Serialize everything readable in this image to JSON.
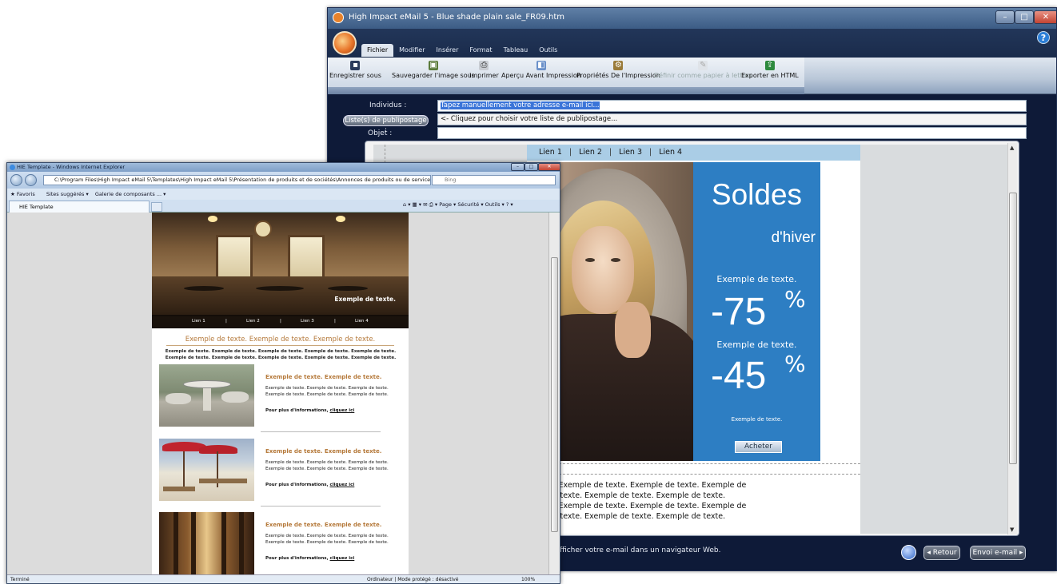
{
  "hie": {
    "title": "High Impact eMail 5 - Blue shade plain sale_FR09.htm",
    "tabs": [
      "Fichier",
      "Modifier",
      "Insérer",
      "Format",
      "Tableau",
      "Outils"
    ],
    "toolbar": [
      {
        "label": "Enregistrer sous",
        "icon": "save-icon",
        "enabled": true
      },
      {
        "label": "Sauvegarder l'image sous",
        "icon": "save-image-icon",
        "enabled": true
      },
      {
        "label": "Imprimer",
        "icon": "print-icon",
        "enabled": true
      },
      {
        "label": "Aperçu Avant Impression",
        "icon": "print-preview-icon",
        "enabled": true
      },
      {
        "label": "Propriétés De l'Impression",
        "icon": "print-properties-icon",
        "enabled": true
      },
      {
        "label": "Définir comme papier à lettres",
        "icon": "stationery-icon",
        "enabled": false
      },
      {
        "label": "Exporter en HTML",
        "icon": "export-html-icon",
        "enabled": true
      }
    ],
    "fields": {
      "individus_label": "Individus :",
      "individus_placeholder": "Tapez manuellement votre adresse e-mail ici...",
      "list_button": "Liste(s) de publipostage :",
      "list_hint": "<- Cliquez pour choisir votre liste de publipostage...",
      "objet_label": "Objet :",
      "objet_value": ""
    },
    "email": {
      "nav": [
        "Lien 1",
        "Lien 2",
        "Lien 3",
        "Lien 4"
      ],
      "sep": "|",
      "headline": "Soldes",
      "subheadline": "d'hiver",
      "example1": "Exemple de texte.",
      "discount1": "-75",
      "pct": "%",
      "example2": "Exemple de texte.",
      "discount2": "-45",
      "example3": "Exemple de texte.",
      "buy_button": "Acheter",
      "body_lines": [
        "de texte. Exemple de texte. Exemple de texte. Exemple de",
        "emple de texte. Exemple de texte. Exemple de texte.",
        "de texte. Exemple de texte. Exemple de texte. Exemple de",
        "emple de texte. Exemple de texte. Exemple de texte."
      ]
    },
    "status_text": "fficher votre e-mail dans un navigateur Web.",
    "back_button": "Retour",
    "send_button": "Envoi e-mail"
  },
  "ie": {
    "title": "HIE Template - Windows Internet Explorer",
    "address": "C:\\Program Files\\High Impact eMail 5\\Templates\\High Impact eMail 5\\Présentation de produits et de sociétés\\Annonces de produits ou de services\\Blu",
    "search_placeholder": "Bing",
    "favorites": [
      "Favoris",
      "Sites suggérés ▾",
      "Galerie de composants ... ▾"
    ],
    "tab_label": "HIE Template",
    "commands": [
      "Page ▾",
      "Sécurité ▾",
      "Outils ▾"
    ],
    "page": {
      "nav": [
        "Lien 1",
        "|",
        "Lien 2",
        "|",
        "Lien 3",
        "|",
        "Lien 4"
      ],
      "hero_caption": "Exemple de texte.",
      "heading": "Exemple de texte. Exemple de texte. Exemple de texte.",
      "intro": "Exemple de texte. Exemple de texte. Exemple de texte. Exemple de texte. Exemple de texte. Exemple de texte. Exemple de texte. Exemple de texte. Exemple de texte. Exemple de texte.",
      "items": [
        {
          "title": "Exemple de texte. Exemple de texte.",
          "text": "Exemple de texte. Exemple de texte. Exemple de texte. Exemple de texte. Exemple de texte. Exemple de texte.",
          "more": "Pour plus d'informations,",
          "link": "cliquez ici"
        },
        {
          "title": "Exemple de texte. Exemple de texte.",
          "text": "Exemple de texte. Exemple de texte. Exemple de texte. Exemple de texte. Exemple de texte. Exemple de texte.",
          "more": "Pour plus d'informations,",
          "link": "cliquez ici"
        },
        {
          "title": "Exemple de texte. Exemple de texte.",
          "text": "Exemple de texte. Exemple de texte. Exemple de texte. Exemple de texte. Exemple de texte. Exemple de texte.",
          "more": "Pour plus d'informations,",
          "link": "cliquez ici"
        }
      ]
    },
    "status_left": "Terminé",
    "status_zone": "Ordinateur | Mode protégé : désactivé",
    "zoom": "100%"
  }
}
